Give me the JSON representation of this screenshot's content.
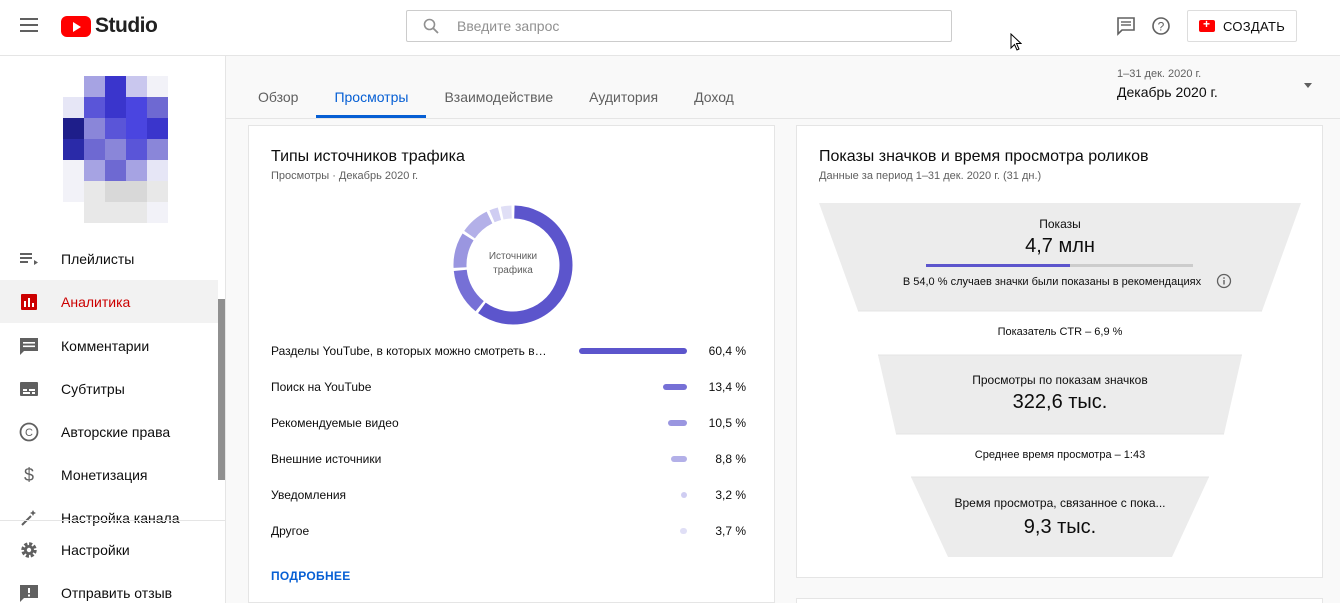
{
  "header": {
    "logo_text": "Studio",
    "search_placeholder": "Введите запрос",
    "create_label": "СОЗДАТЬ"
  },
  "sidebar": {
    "items": [
      {
        "label": "Плейлисты",
        "icon": "playlist-icon"
      },
      {
        "label": "Аналитика",
        "icon": "analytics-icon",
        "active": true
      },
      {
        "label": "Комментарии",
        "icon": "comments-icon"
      },
      {
        "label": "Субтитры",
        "icon": "subtitles-icon"
      },
      {
        "label": "Авторские права",
        "icon": "copyright-icon"
      },
      {
        "label": "Монетизация",
        "icon": "dollar-icon"
      },
      {
        "label": "Настройка канала",
        "icon": "customization-icon"
      }
    ],
    "bottom_items": [
      {
        "label": "Настройки",
        "icon": "gear-icon"
      },
      {
        "label": "Отправить отзыв",
        "icon": "feedback-icon"
      }
    ]
  },
  "tabs": [
    {
      "label": "Обзор"
    },
    {
      "label": "Просмотры",
      "active": true
    },
    {
      "label": "Взаимодействие"
    },
    {
      "label": "Аудитория"
    },
    {
      "label": "Доход"
    }
  ],
  "date_selector": {
    "range": "1–31 дек. 2020 г.",
    "value": "Декабрь 2020 г."
  },
  "traffic_card": {
    "title": "Типы источников трафика",
    "subtitle": "Просмотры · Декабрь 2020 г.",
    "donut_label": "Источники трафика",
    "sources": [
      {
        "name": "Разделы YouTube, в которых можно смотреть ви...",
        "pct": "60,4 %",
        "value": 60.4,
        "color": "#5c55cc"
      },
      {
        "name": "Поиск на YouTube",
        "pct": "13,4 %",
        "value": 13.4,
        "color": "#7670d6"
      },
      {
        "name": "Рекомендуемые видео",
        "pct": "10,5 %",
        "value": 10.5,
        "color": "#9a96e0"
      },
      {
        "name": "Внешние источники",
        "pct": "8,8 %",
        "value": 8.8,
        "color": "#b3b0e8"
      },
      {
        "name": "Уведомления",
        "pct": "3,2 %",
        "value": 3.2,
        "color": "#cfcdf2"
      },
      {
        "name": "Другое",
        "pct": "3,7 %",
        "value": 3.7,
        "color": "#e0dff6"
      }
    ],
    "more_label": "ПОДРОБНЕЕ"
  },
  "funnel_card": {
    "title": "Показы значков и время просмотра роликов",
    "subtitle": "Данные за период 1–31 дек. 2020 г. (31 дн.)",
    "impressions_label": "Показы",
    "impressions_value": "4,7 млн",
    "recommend_share": 0.54,
    "recommend_text": "В 54,0 % случаев значки были показаны в рекомендациях",
    "ctr_text": "Показатель CTR – 6,9 %",
    "views_label": "Просмотры по показам значков",
    "views_value": "322,6 тыс.",
    "avg_time_text": "Среднее время просмотра – 1:43",
    "watch_label": "Время просмотра, связанное с пока...",
    "watch_value": "9,3 тыс."
  }
}
